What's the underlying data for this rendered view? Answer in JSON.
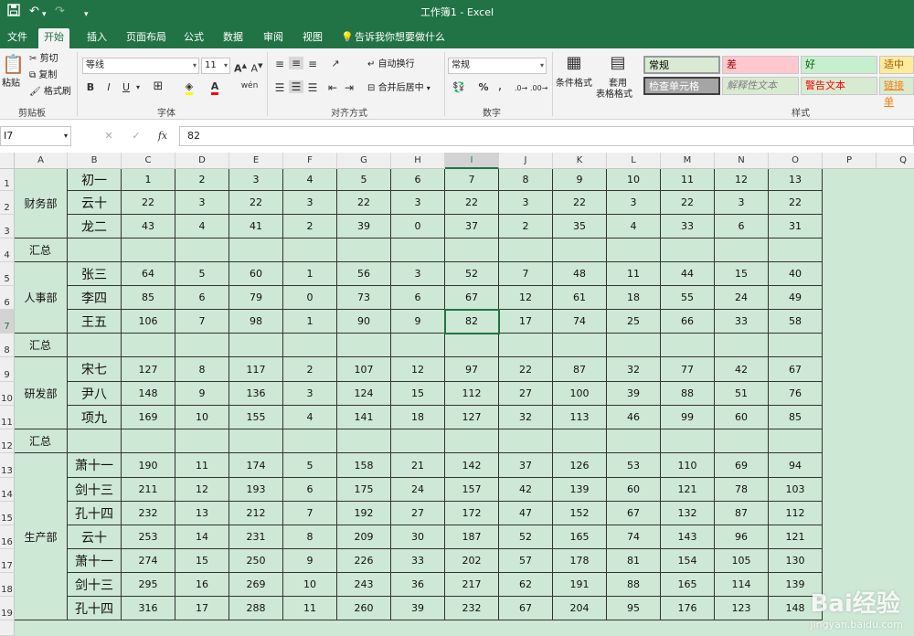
{
  "window": {
    "title": "工作簿1  -  Excel"
  },
  "quick_access": {
    "save_icon": "save-icon",
    "undo_icon": "undo-icon",
    "redo_icon": "redo-icon",
    "customize_icon": "chevron-down-icon"
  },
  "tabs": [
    {
      "label": "文件"
    },
    {
      "label": "开始",
      "active": true
    },
    {
      "label": "插入"
    },
    {
      "label": "页面布局"
    },
    {
      "label": "公式"
    },
    {
      "label": "数据"
    },
    {
      "label": "审阅"
    },
    {
      "label": "视图"
    },
    {
      "label": "告诉我你想要做什么"
    }
  ],
  "ribbon": {
    "clipboard": {
      "paste": "粘贴",
      "cut": "剪切",
      "copy": "复制",
      "format_painter": "格式刷",
      "group": "剪贴板"
    },
    "font": {
      "name": "等线",
      "size": "11",
      "bold": "B",
      "italic": "I",
      "underline": "U",
      "grow": "A",
      "shrink": "A",
      "wen": "wén",
      "group": "字体"
    },
    "alignment": {
      "wrap": "自动换行",
      "merge": "合并后居中",
      "group": "对齐方式"
    },
    "number": {
      "format": "常规",
      "percent": "%",
      "comma": ",",
      "group": "数字"
    },
    "styles": {
      "cond_format": "条件格式",
      "table_format_1": "套用",
      "table_format_2": "表格格式",
      "items": [
        {
          "label": "常规",
          "bg": "#d9ead3",
          "fg": "#000000"
        },
        {
          "label": "差",
          "bg": "#ffc7ce",
          "fg": "#9c0006"
        },
        {
          "label": "好",
          "bg": "#c6efce",
          "fg": "#006100"
        },
        {
          "label": "适中",
          "bg": "#ffeb9c",
          "fg": "#9c5700"
        },
        {
          "label": "检查单元格",
          "bg": "#a5a5a5",
          "fg": "#ffffff"
        },
        {
          "label": "解释性文本",
          "bg": "#d9ead3",
          "fg": "#7f7f7f"
        },
        {
          "label": "警告文本",
          "bg": "#d9ead3",
          "fg": "#ff0000"
        },
        {
          "label": "链接单",
          "bg": "#d9ead3",
          "fg": "#fa7d00"
        }
      ],
      "group": "样式"
    }
  },
  "formula_bar": {
    "name_box": "I7",
    "cancel": "✕",
    "enter": "✓",
    "fx": "fx",
    "value": "82"
  },
  "columns": [
    "A",
    "B",
    "C",
    "D",
    "E",
    "F",
    "G",
    "H",
    "I",
    "J",
    "K",
    "L",
    "M",
    "N",
    "O",
    "P",
    "Q"
  ],
  "rows": [
    "1",
    "2",
    "3",
    "4",
    "5",
    "6",
    "7",
    "8",
    "9",
    "10",
    "11",
    "12",
    "13",
    "14",
    "15",
    "16",
    "17",
    "18",
    "19"
  ],
  "selected": {
    "col": "I",
    "row": "7"
  },
  "departments": [
    {
      "label": "财务部"
    },
    {
      "label": "汇总"
    },
    {
      "label": "人事部"
    },
    {
      "label": "汇总"
    },
    {
      "label": "研发部"
    },
    {
      "label": "汇总"
    },
    {
      "label": "生产部"
    }
  ],
  "sheet_rows": [
    {
      "name": "初一",
      "values": [
        "1",
        "2",
        "3",
        "4",
        "5",
        "6",
        "7",
        "8",
        "9",
        "10",
        "11",
        "12",
        "13"
      ]
    },
    {
      "name": "云十",
      "values": [
        "22",
        "3",
        "22",
        "3",
        "22",
        "3",
        "22",
        "3",
        "22",
        "3",
        "22",
        "3",
        "22"
      ]
    },
    {
      "name": "龙二",
      "values": [
        "43",
        "4",
        "41",
        "2",
        "39",
        "0",
        "37",
        "2",
        "35",
        "4",
        "33",
        "6",
        "31"
      ]
    },
    {
      "name": "",
      "values": [
        "",
        "",
        "",
        "",
        "",
        "",
        "",
        "",
        "",
        "",
        "",
        "",
        ""
      ]
    },
    {
      "name": "张三",
      "values": [
        "64",
        "5",
        "60",
        "1",
        "56",
        "3",
        "52",
        "7",
        "48",
        "11",
        "44",
        "15",
        "40"
      ]
    },
    {
      "name": "李四",
      "values": [
        "85",
        "6",
        "79",
        "0",
        "73",
        "6",
        "67",
        "12",
        "61",
        "18",
        "55",
        "24",
        "49"
      ]
    },
    {
      "name": "王五",
      "values": [
        "106",
        "7",
        "98",
        "1",
        "90",
        "9",
        "82",
        "17",
        "74",
        "25",
        "66",
        "33",
        "58"
      ]
    },
    {
      "name": "",
      "values": [
        "",
        "",
        "",
        "",
        "",
        "",
        "",
        "",
        "",
        "",
        "",
        "",
        ""
      ]
    },
    {
      "name": "宋七",
      "values": [
        "127",
        "8",
        "117",
        "2",
        "107",
        "12",
        "97",
        "22",
        "87",
        "32",
        "77",
        "42",
        "67"
      ]
    },
    {
      "name": "尹八",
      "values": [
        "148",
        "9",
        "136",
        "3",
        "124",
        "15",
        "112",
        "27",
        "100",
        "39",
        "88",
        "51",
        "76"
      ]
    },
    {
      "name": "项九",
      "values": [
        "169",
        "10",
        "155",
        "4",
        "141",
        "18",
        "127",
        "32",
        "113",
        "46",
        "99",
        "60",
        "85"
      ]
    },
    {
      "name": "",
      "values": [
        "",
        "",
        "",
        "",
        "",
        "",
        "",
        "",
        "",
        "",
        "",
        "",
        ""
      ]
    },
    {
      "name": "萧十一",
      "values": [
        "190",
        "11",
        "174",
        "5",
        "158",
        "21",
        "142",
        "37",
        "126",
        "53",
        "110",
        "69",
        "94"
      ]
    },
    {
      "name": "剑十三",
      "values": [
        "211",
        "12",
        "193",
        "6",
        "175",
        "24",
        "157",
        "42",
        "139",
        "60",
        "121",
        "78",
        "103"
      ]
    },
    {
      "name": "孔十四",
      "values": [
        "232",
        "13",
        "212",
        "7",
        "192",
        "27",
        "172",
        "47",
        "152",
        "67",
        "132",
        "87",
        "112"
      ]
    },
    {
      "name": "云十",
      "values": [
        "253",
        "14",
        "231",
        "8",
        "209",
        "30",
        "187",
        "52",
        "165",
        "74",
        "143",
        "96",
        "121"
      ]
    },
    {
      "name": "萧十一",
      "values": [
        "274",
        "15",
        "250",
        "9",
        "226",
        "33",
        "202",
        "57",
        "178",
        "81",
        "154",
        "105",
        "130"
      ]
    },
    {
      "name": "剑十三",
      "values": [
        "295",
        "16",
        "269",
        "10",
        "243",
        "36",
        "217",
        "62",
        "191",
        "88",
        "165",
        "114",
        "139"
      ]
    },
    {
      "name": "孔十四",
      "values": [
        "316",
        "17",
        "288",
        "11",
        "260",
        "39",
        "232",
        "67",
        "204",
        "95",
        "176",
        "123",
        "148"
      ]
    }
  ],
  "watermark": {
    "brand": "Bai经验",
    "url": "jingyan.baidu.com"
  }
}
